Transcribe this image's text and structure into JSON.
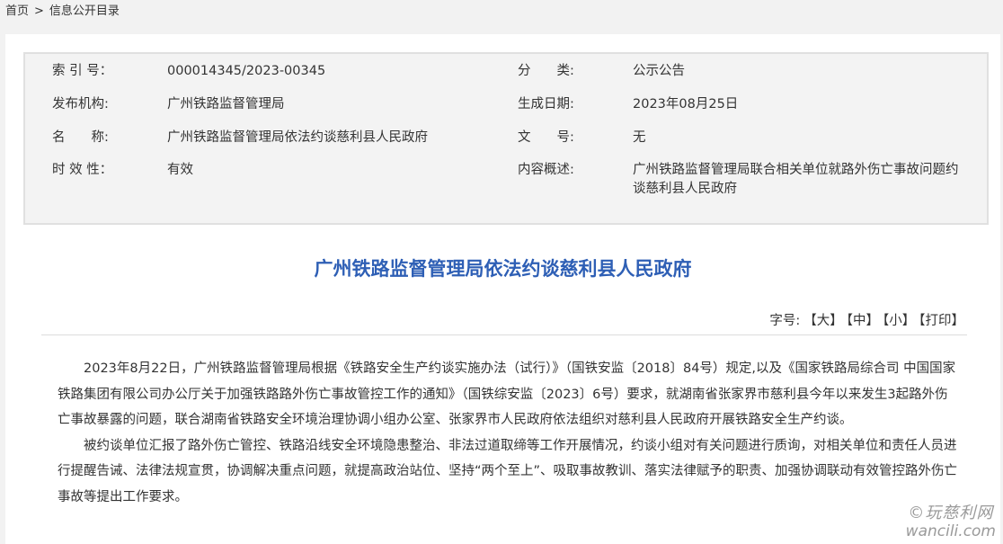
{
  "breadcrumb": {
    "home": "首页",
    "separator": ">",
    "current": "信息公开目录"
  },
  "meta": {
    "index_label": "索 引 号：",
    "index_value": "000014345/2023-00345",
    "category_label": "分　　类:",
    "category_value": "公示公告",
    "publisher_label": "发布机构:",
    "publisher_value": "广州铁路监督管理局",
    "date_label": "生成日期:",
    "date_value": "2023年08月25日",
    "name_label": "名　　称:",
    "name_value": "广州铁路监督管理局依法约谈慈利县人民政府",
    "docno_label": "文　　号:",
    "docno_value": "无",
    "validity_label": "时 效 性：",
    "validity_value": "有效",
    "summary_label": "内容概述:",
    "summary_value": "广州铁路监督管理局联合相关单位就路外伤亡事故问题约谈慈利县人民政府"
  },
  "article": {
    "title": "广州铁路监督管理局依法约谈慈利县人民政府",
    "font_size_label": "字号:",
    "font_large": "【大】",
    "font_medium": "【中】",
    "font_small": "【小】",
    "print": "【打印】",
    "paragraphs": [
      "2023年8月22日，广州铁路监督管理局根据《铁路安全生产约谈实施办法（试行）》（国铁安监〔2018〕84号）规定,以及《国家铁路局综合司 中国国家铁路集团有限公司办公厅关于加强铁路路外伤亡事故管控工作的通知》（国铁综安监〔2023〕6号）要求，就湖南省张家界市慈利县今年以来发生3起路外伤亡事故暴露的问题，联合湖南省铁路安全环境治理协调小组办公室、张家界市人民政府依法组织对慈利县人民政府开展铁路安全生产约谈。",
      "被约谈单位汇报了路外伤亡管控、铁路沿线安全环境隐患整治、非法过道取缔等工作开展情况，约谈小组对有关问题进行质询，对相关单位和责任人员进行提醒告诫、法律法规宣贯，协调解决重点问题，就提高政治站位、坚持“两个至上”、吸取事故教训、落实法律赋予的职责、加强协调联动有效管控路外伤亡事故等提出工作要求。"
    ]
  },
  "watermark": {
    "cn": "©玩慈利网",
    "en": "wancili.com"
  }
}
